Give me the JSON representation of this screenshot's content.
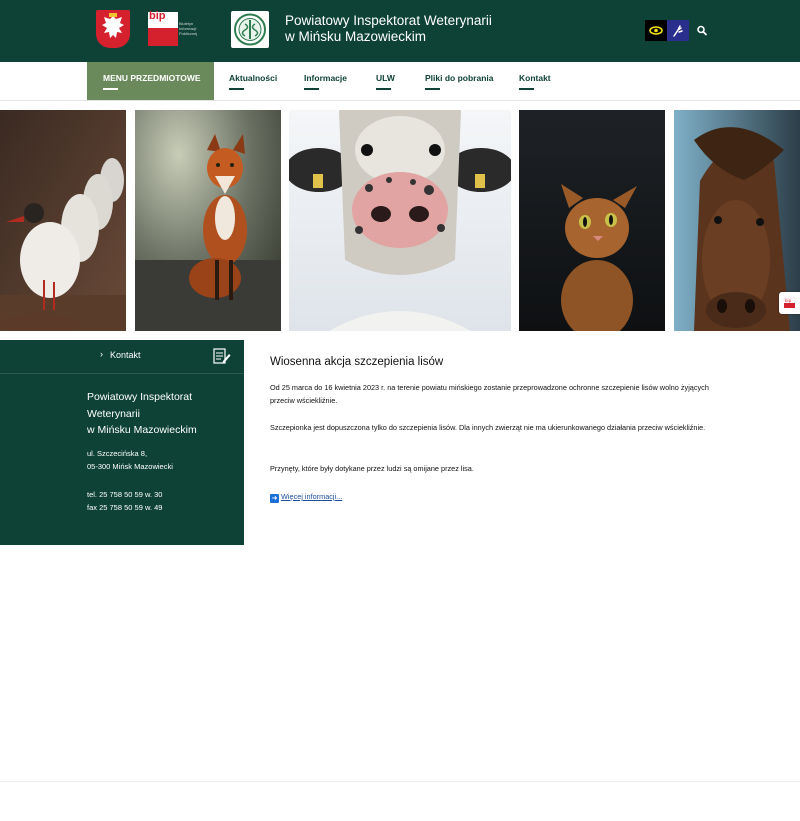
{
  "header": {
    "title_line1": "Powiatowy Inspektorat Weterynarii",
    "title_line2": "w Mińsku Mazowieckim",
    "bip_text": "bip",
    "bip_sub": "Biuletyn Informacji Publicznej",
    "icons": [
      "poland-emblem-icon",
      "bip-logo-icon",
      "veterinary-logo-icon",
      "eye-contrast-icon",
      "sign-language-icon",
      "search-icon"
    ]
  },
  "nav": {
    "items": [
      {
        "label": "MENU PRZEDMIOTOWE"
      },
      {
        "label": "Aktualności"
      },
      {
        "label": "Informacje"
      },
      {
        "label": "ULW"
      },
      {
        "label": "Pliki do pobrania"
      },
      {
        "label": "Kontakt"
      }
    ]
  },
  "gallery": {
    "photos": [
      "seagulls",
      "fox",
      "cow",
      "cat",
      "horse"
    ]
  },
  "sidebar": {
    "contact_label": "Kontakt",
    "name_line1": "Powiatowy Inspektorat",
    "name_line2": "Weterynarii",
    "name_line3": "w Mińsku Mazowieckim",
    "address_line1": "ul. Szczecińska 8,",
    "address_line2": "05-300 Mińsk Mazowiecki",
    "phone": "tel. 25 758 50 59 w. 30",
    "fax": "fax 25 758 50 59 w. 49"
  },
  "article": {
    "title": "Wiosenna akcja szczepienia lisów",
    "p1": "Od 25 marca do 16 kwietnia 2023 r. na terenie powiatu mińskiego zostanie przeprowadzone ochronne szczepienie lisów wolno żyjących przeciw wściekliźnie.",
    "p2": "Szczepionka jest dopuszczona tylko do szczepienia lisów. Dla innych zwierząt nie ma ukierunkowanego działania przeciw wściekliźnie.",
    "p3": "Przynęty, które były dotykane przez ludzi są omijane przez lisa.",
    "more": "Więcej informacji..."
  },
  "colors": {
    "primary": "#0e4236",
    "menu_accent": "#6b8a5c",
    "poland_red": "#d5202e",
    "link": "#1b4f9c"
  }
}
